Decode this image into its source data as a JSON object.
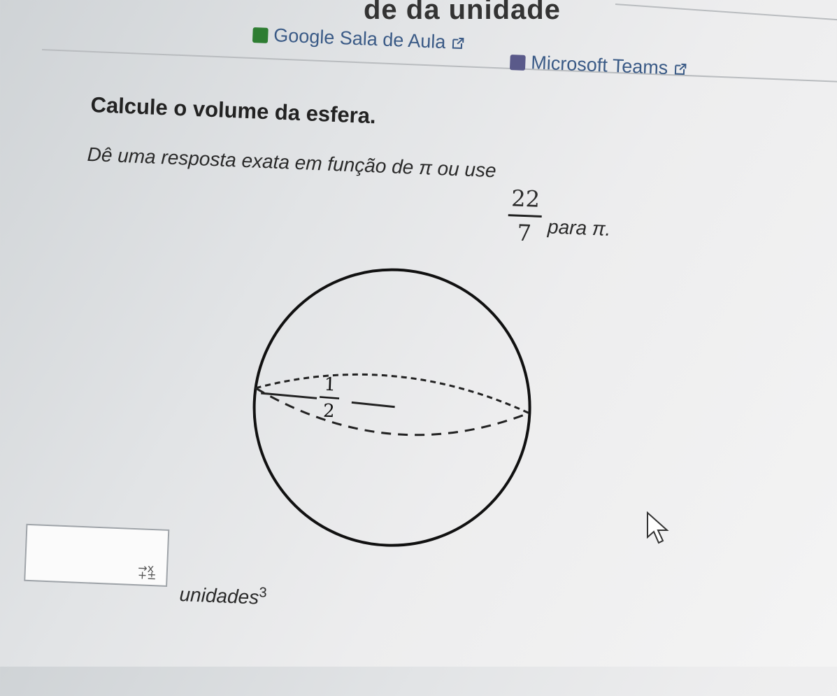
{
  "header": {
    "title": "de da unidade"
  },
  "links": [
    {
      "label": "Google Sala de Aula",
      "icon": "google-classroom-icon",
      "color": "#2e7d32"
    },
    {
      "label": "Microsoft Teams",
      "icon": "microsoft-teams-icon",
      "color": "#5a5a8a"
    }
  ],
  "question": {
    "title": "Calcule o volume da esfera.",
    "instruction_prefix": "Dê uma resposta exata em função de π ou use",
    "fraction_numerator": "22",
    "fraction_denominator": "7",
    "instruction_suffix": "para π."
  },
  "figure": {
    "radius_numerator": "1",
    "radius_denominator": "2"
  },
  "answer": {
    "value": "",
    "units_label": "unidades",
    "units_exponent": "3",
    "math_toolbar_icon": "math-format-icon"
  }
}
